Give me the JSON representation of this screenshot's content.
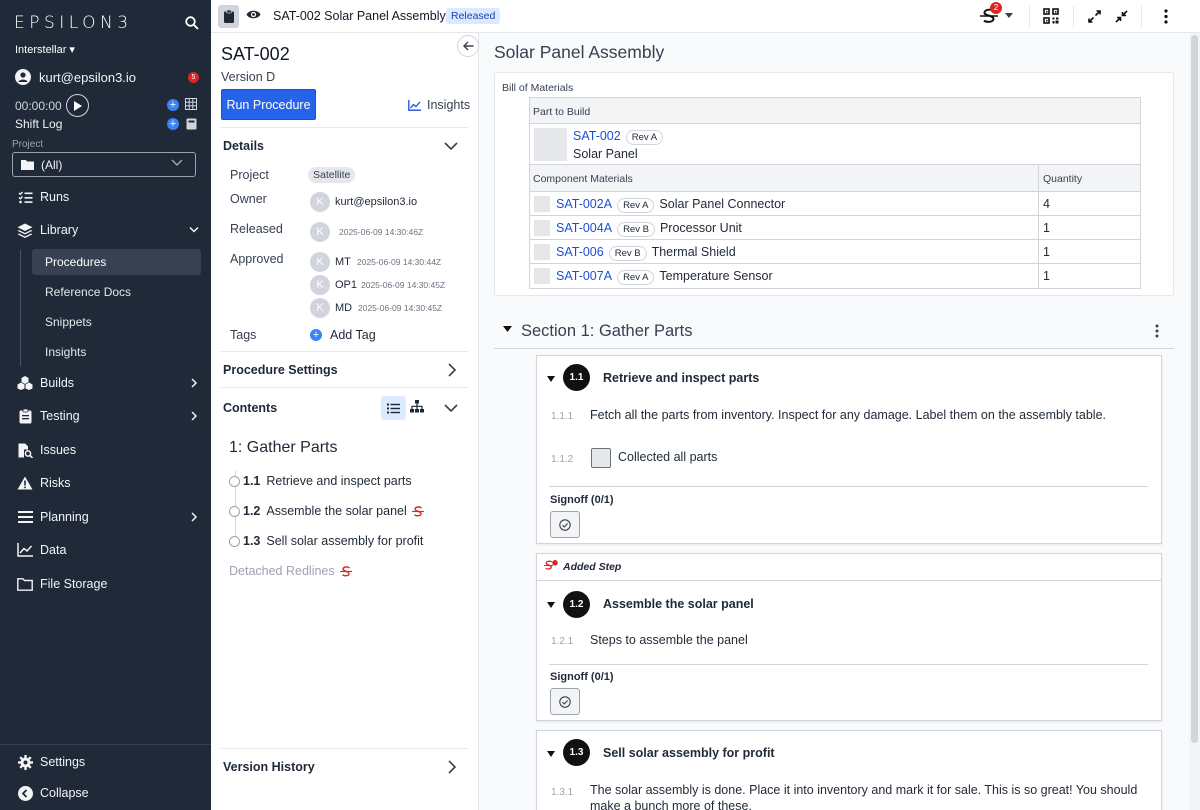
{
  "sidebar": {
    "logo": "EPSILON3",
    "org": "Interstellar",
    "user": "kurt@epsilon3.io",
    "notifications": "5",
    "timer": "00:00:00",
    "shift_log": "Shift Log",
    "project_label": "Project",
    "project_value": "(All)",
    "nav": {
      "runs": "Runs",
      "library": "Library",
      "procedures": "Procedures",
      "reference_docs": "Reference Docs",
      "snippets": "Snippets",
      "insights": "Insights",
      "builds": "Builds",
      "testing": "Testing",
      "issues": "Issues",
      "risks": "Risks",
      "planning": "Planning",
      "data": "Data",
      "file_storage": "File Storage",
      "settings": "Settings",
      "collapse": "Collapse"
    }
  },
  "topbar": {
    "title": "SAT-002 Solar Panel Assembly",
    "status": "Released",
    "redline_count": "2"
  },
  "procedure": {
    "id": "SAT-002",
    "version": "Version D",
    "run_button": "Run Procedure",
    "insights": "Insights",
    "details": {
      "header": "Details",
      "project_label": "Project",
      "project": "Satellite",
      "owner_label": "Owner",
      "owner_initial": "K",
      "owner": "kurt@epsilon3.io",
      "released_label": "Released",
      "released_initial": "K",
      "released_ts": "2025-06-09 14:30:46Z",
      "approved_label": "Approved",
      "approvals": [
        {
          "initial": "K",
          "role": "MT",
          "ts": "2025-06-09 14:30:44Z"
        },
        {
          "initial": "K",
          "role": "OP1",
          "ts": "2025-06-09 14:30:45Z"
        },
        {
          "initial": "K",
          "role": "MD",
          "ts": "2025-06-09 14:30:45Z"
        }
      ],
      "tags_label": "Tags",
      "add_tag": "Add Tag"
    },
    "settings_header": "Procedure Settings",
    "contents_header": "Contents",
    "contents": {
      "section_title": "1: Gather Parts",
      "items": [
        {
          "num": "1.1",
          "title": "Retrieve and inspect parts"
        },
        {
          "num": "1.2",
          "title": "Assemble the solar panel"
        },
        {
          "num": "1.3",
          "title": "Sell solar assembly for profit"
        }
      ],
      "detached": "Detached Redlines"
    },
    "version_history": "Version History"
  },
  "main": {
    "title": "Solar Panel Assembly",
    "bom": {
      "label": "Bill of Materials",
      "part_header": "Part to Build",
      "part_id": "SAT-002",
      "part_rev": "Rev A",
      "part_name": "Solar Panel",
      "comp_header": "Component Materials",
      "qty_header": "Quantity",
      "components": [
        {
          "id": "SAT-002A",
          "rev": "Rev A",
          "name": "Solar Panel Connector",
          "qty": "4"
        },
        {
          "id": "SAT-004A",
          "rev": "Rev B",
          "name": "Processor Unit",
          "qty": "1"
        },
        {
          "id": "SAT-006",
          "rev": "Rev B",
          "name": "Thermal Shield",
          "qty": "1"
        },
        {
          "id": "SAT-007A",
          "rev": "Rev A",
          "name": "Temperature Sensor",
          "qty": "1"
        }
      ]
    },
    "section": {
      "title": "Section 1: Gather Parts",
      "steps": [
        {
          "num": "1.1",
          "title": "Retrieve and inspect parts",
          "sub1_num": "1.1.1",
          "sub1_text": "Fetch all the parts from inventory.  Inspect for any damage.  Label them on the assembly table.",
          "sub2_num": "1.1.2",
          "sub2_text": "Collected all parts",
          "signoff": "Signoff (0/1)"
        },
        {
          "added_label": "Added Step",
          "num": "1.2",
          "title": "Assemble the solar panel",
          "sub1_num": "1.2.1",
          "sub1_text": "Steps to assemble the panel",
          "signoff": "Signoff (0/1)"
        },
        {
          "num": "1.3",
          "title": "Sell solar assembly for profit",
          "sub1_num": "1.3.1",
          "sub1_text": "The solar assembly is done.  Place it into inventory and mark it for sale.  This is so great!  You should make a bunch more of these."
        }
      ]
    }
  }
}
